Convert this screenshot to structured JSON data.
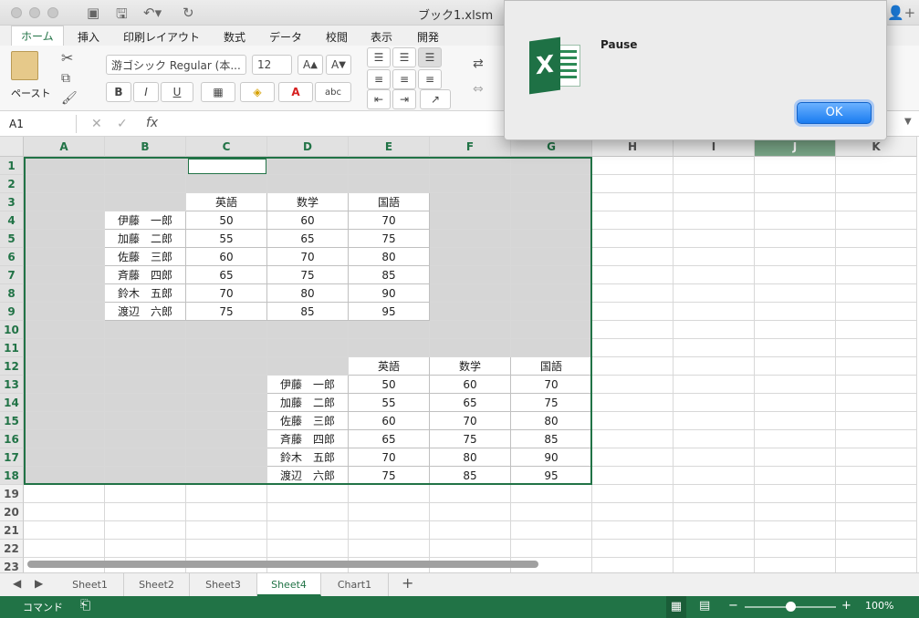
{
  "window": {
    "title": "ブック1.xlsm"
  },
  "ribbon_tabs": [
    "ホーム",
    "挿入",
    "印刷レイアウト",
    "数式",
    "データ",
    "校閲",
    "表示",
    "開発"
  ],
  "ribbon": {
    "paste_label": "ペースト",
    "font_name": "游ゴシック Regular (本...",
    "font_size": "12",
    "bold": "B",
    "italic": "I",
    "underline": "U",
    "abc": "abc"
  },
  "formula_bar": {
    "name_box": "A1",
    "fx": "fx",
    "value": ""
  },
  "columns": [
    "A",
    "B",
    "C",
    "D",
    "E",
    "F",
    "G",
    "H",
    "I",
    "J",
    "K"
  ],
  "rows": [
    "1",
    "2",
    "3",
    "4",
    "5",
    "6",
    "7",
    "8",
    "9",
    "10",
    "11",
    "12",
    "13",
    "14",
    "15",
    "16",
    "17",
    "18",
    "19",
    "20",
    "21",
    "22",
    "23"
  ],
  "table1": {
    "headers": [
      "英語",
      "数学",
      "国語"
    ],
    "rows": [
      {
        "name": "伊藤　一郎",
        "en": "50",
        "math": "60",
        "ja": "70"
      },
      {
        "name": "加藤　二郎",
        "en": "55",
        "math": "65",
        "ja": "75"
      },
      {
        "name": "佐藤　三郎",
        "en": "60",
        "math": "70",
        "ja": "80"
      },
      {
        "name": "斉藤　四郎",
        "en": "65",
        "math": "75",
        "ja": "85"
      },
      {
        "name": "鈴木　五郎",
        "en": "70",
        "math": "80",
        "ja": "90"
      },
      {
        "name": "渡辺　六郎",
        "en": "75",
        "math": "85",
        "ja": "95"
      }
    ]
  },
  "table2": {
    "headers": [
      "英語",
      "数学",
      "国語"
    ],
    "rows": [
      {
        "name": "伊藤　一郎",
        "en": "50",
        "math": "60",
        "ja": "70"
      },
      {
        "name": "加藤　二郎",
        "en": "55",
        "math": "65",
        "ja": "75"
      },
      {
        "name": "佐藤　三郎",
        "en": "60",
        "math": "70",
        "ja": "80"
      },
      {
        "name": "斉藤　四郎",
        "en": "65",
        "math": "75",
        "ja": "85"
      },
      {
        "name": "鈴木　五郎",
        "en": "70",
        "math": "80",
        "ja": "90"
      },
      {
        "name": "渡辺　六郎",
        "en": "75",
        "math": "85",
        "ja": "95"
      }
    ]
  },
  "sheets": [
    "Sheet1",
    "Sheet2",
    "Sheet3",
    "Sheet4",
    "Chart1"
  ],
  "active_sheet": "Sheet4",
  "status": {
    "mode": "コマンド",
    "zoom": "100%"
  },
  "dialog": {
    "message": "Pause",
    "ok_label": "OK"
  },
  "colors": {
    "excel_green": "#217346",
    "shade": "#d6d6d6",
    "ok_blue": "#1a7cf0"
  }
}
